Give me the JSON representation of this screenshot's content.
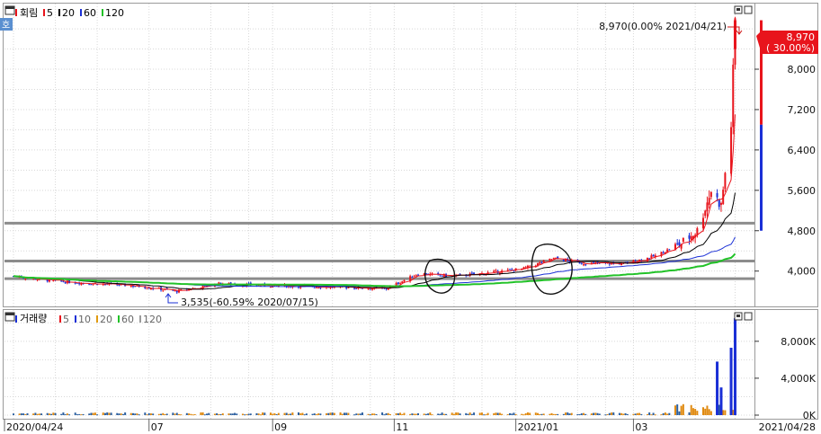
{
  "price_panel": {
    "title": "회림",
    "legend": [
      {
        "label": "5",
        "color": "#e8141c"
      },
      {
        "label": "20",
        "color": "#000000"
      },
      {
        "label": "60",
        "color": "#1a2fd6"
      },
      {
        "label": "120",
        "color": "#22c228"
      }
    ],
    "side_button": "호",
    "current_price_label": "8,970",
    "current_change_label": "( 30.00%)",
    "high_annotation": "8,970(0.00% 2021/04/21)",
    "low_annotation": "3,535(-60.59% 2020/07/15)"
  },
  "volume_panel": {
    "title": "거래량",
    "legend": [
      {
        "label": "5",
        "color": "#e8141c"
      },
      {
        "label": "10",
        "color": "#1a2fd6"
      },
      {
        "label": "20",
        "color": "#e09a10"
      },
      {
        "label": "60",
        "color": "#22c228"
      },
      {
        "label": "120",
        "color": "#9a9a9a"
      }
    ]
  },
  "x_axis_labels": [
    "2020/04/24",
    "07",
    "09",
    "11",
    "2021/01",
    "03",
    "2021/04/28"
  ],
  "colors": {
    "up": "#e8141c",
    "down": "#1a2fd6",
    "grid": "#d8d8d8",
    "hline": "#8c8c8c"
  },
  "chart_data": [
    {
      "type": "candlestick",
      "title": "회림",
      "x_start": "2020/04/24",
      "x_end": "2021/04/28",
      "ylim": [
        3300,
        9300
      ],
      "y_ticks": [
        4000,
        4800,
        5600,
        6400,
        7200,
        8000
      ],
      "y_tick_labels": [
        "4,000",
        "4,800",
        "5,600",
        "6,400",
        "7,200",
        "8,000"
      ],
      "close_series": {
        "dates": [
          "2020/04/24",
          "2020/05/15",
          "2020/06/05",
          "2020/06/26",
          "2020/07/15",
          "2020/08/05",
          "2020/08/26",
          "2020/09/16",
          "2020/10/07",
          "2020/10/28",
          "2020/11/13",
          "2020/11/30",
          "2020/12/15",
          "2021/01/05",
          "2021/01/20",
          "2021/02/05",
          "2021/02/25",
          "2021/03/12",
          "2021/03/25",
          "2021/04/02",
          "2021/04/09",
          "2021/04/14",
          "2021/04/19",
          "2021/04/21"
        ],
        "values": [
          3900,
          3800,
          3750,
          3700,
          3600,
          3750,
          3720,
          3700,
          3680,
          3650,
          3950,
          3900,
          3950,
          4050,
          4250,
          4150,
          4150,
          4300,
          4550,
          4800,
          5600,
          5300,
          6900,
          8970
        ]
      },
      "moving_averages": [
        {
          "name": "5",
          "color": "#e8141c"
        },
        {
          "name": "20",
          "color": "#000000"
        },
        {
          "name": "60",
          "color": "#1a2fd6"
        },
        {
          "name": "120",
          "color": "#22c228"
        }
      ],
      "horizontal_lines": [
        4950,
        4200,
        3850
      ],
      "annotations": [
        {
          "text": "8,970(0.00% 2021/04/21)",
          "date": "2021/04/21",
          "value": 8970
        },
        {
          "text": "3,535(-60.59% 2020/07/15)",
          "date": "2020/07/15",
          "value": 3535
        }
      ],
      "last_price": 8970,
      "last_change_pct": 30.0,
      "grid": true
    },
    {
      "type": "bar",
      "title": "거래량",
      "ylim": [
        0,
        11000000
      ],
      "y_ticks": [
        0,
        4000000,
        8000000
      ],
      "y_tick_labels": [
        "0K",
        "4,000K",
        "8,000K"
      ],
      "spikes": [
        {
          "date": "2021/04/12",
          "value": 5800000
        },
        {
          "date": "2021/04/14",
          "value": 3000000
        },
        {
          "date": "2021/04/19",
          "value": 7300000
        },
        {
          "date": "2021/04/21",
          "value": 10500000
        }
      ],
      "baseline_volume": 150000,
      "grid": true
    }
  ]
}
